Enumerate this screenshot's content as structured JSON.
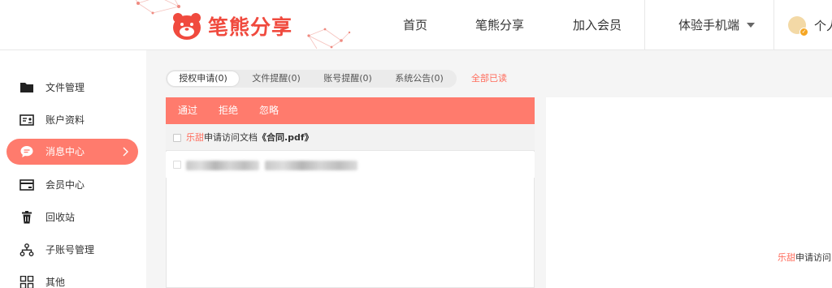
{
  "brand": {
    "name": "笔熊分享",
    "color": "#f04a3e",
    "logo_icon": "bear-logo-icon"
  },
  "nav": {
    "home": "首页",
    "share": "笔熊分享",
    "member": "加入会员",
    "mobile": "体验手机端",
    "user": "个人"
  },
  "sidebar": {
    "items": [
      {
        "label": "文件管理",
        "icon": "folder-icon"
      },
      {
        "label": "账户资料",
        "icon": "id-card-icon"
      },
      {
        "label": "消息中心",
        "icon": "message-icon",
        "active": true
      },
      {
        "label": "会员中心",
        "icon": "vip-card-icon"
      },
      {
        "label": "回收站",
        "icon": "trash-icon"
      },
      {
        "label": "子账号管理",
        "icon": "org-tree-icon"
      },
      {
        "label": "其他",
        "icon": "grid-icon"
      }
    ],
    "active_color": "#ff7b6d"
  },
  "tabs": [
    {
      "label": "授权申请(0)",
      "active": true
    },
    {
      "label": "文件提醒(0)"
    },
    {
      "label": "账号提醒(0)"
    },
    {
      "label": "系统公告(0)"
    }
  ],
  "mark_all_read": "全部已读",
  "actions": {
    "approve": "通过",
    "reject": "拒绝",
    "ignore": "忽略"
  },
  "messages": [
    {
      "requester": "乐甜",
      "action": "申请访问文档",
      "document": "《合同.pdf》"
    }
  ],
  "detail": {
    "requester": "乐甜",
    "action": "申请访问"
  }
}
